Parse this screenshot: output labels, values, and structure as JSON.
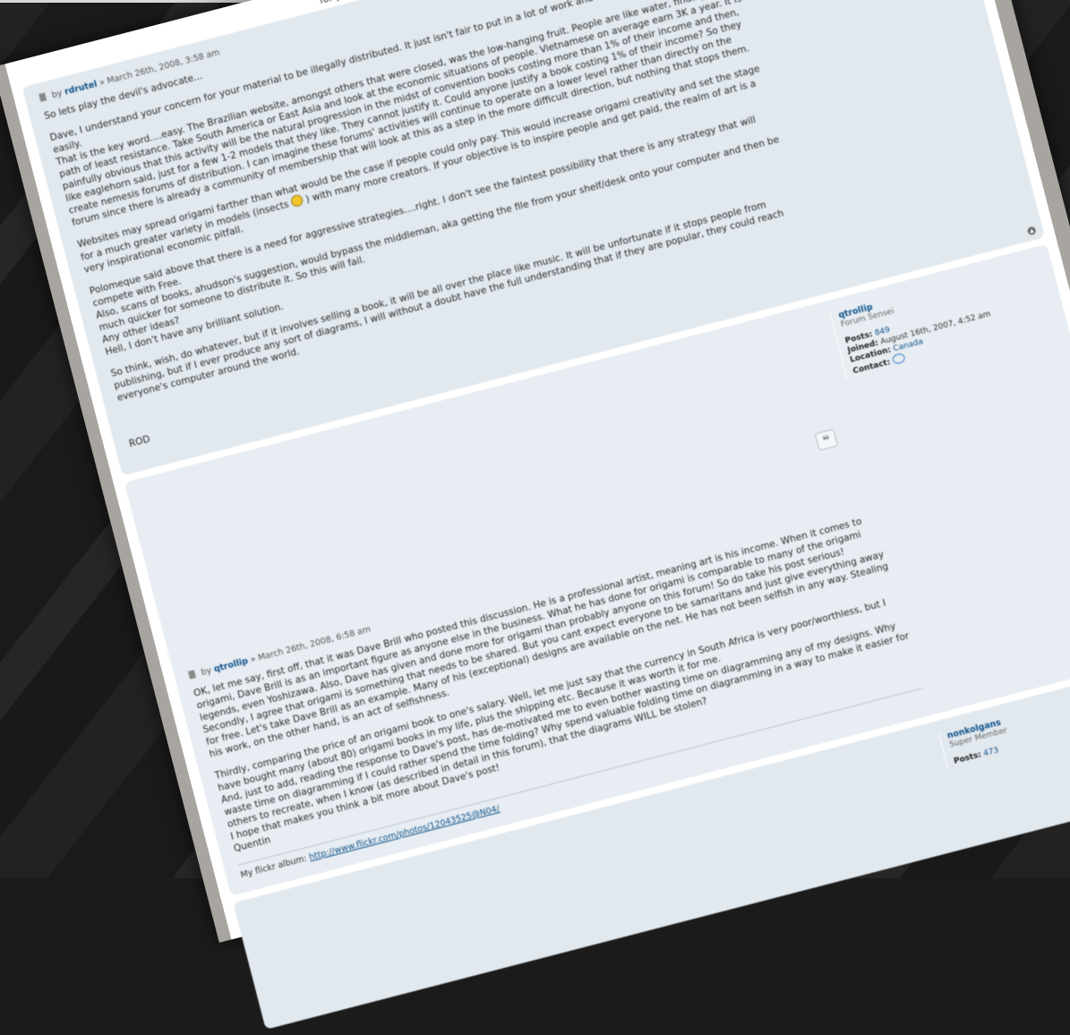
{
  "post1": {
    "author": "rdrutel",
    "by": "by",
    "date": "» March 26th, 2008, 3:58 am",
    "top_header_text": "for your material to be illegally distributed. It just isn't fair to put in a lot of work and effort and have it taken",
    "paragraphs": [
      "So lets play the devil's advocate...",
      "Dave, I understand your concern for your material to be illegally distributed. It just isn't fair to put in a lot of work and effort and have it taken easily.",
      "That is the key word....easy. The Brazilian website, amongst others that were closed, was the low-hanging fruit. People are like water, finding the path of least resistance. Take South America or East Asia and look at the economic situations of people. Vietnamese on average earn 3K a year. It is painfully obvious that this activity will be the natural progression in the midst of convention books costing more than 1% of their income and then, like eaglehorn said, just for a few 1-2 models that they like. They cannot justify it. Could anyone justify a book costing 1% of their income? So they create nemesis forums of distribution. I can imagine these forums' activities will continue to operate on a lower level rather than directly on the forum since there is already a community of membership that will look at this as a step in the more difficult direction, but nothing that stops them.",
      "Websites may spread origami farther than what would be the case if people could only pay. This would increase origami creativity and set the stage for a much greater variety in models (insects",
      ") with many more creators. If your objective is to inspire people and get paid, the realm of art is a very inspirational economic pitfall.",
      "Polomeque said above that there is a need for aggressive strategies....right. I don't see the faintest possibility that there is any strategy that will compete with Free.",
      "Also, scans of books, ahudson's suggestion, would bypass the middleman, aka getting the file from your shelf/desk onto your computer and then be much quicker for someone to distribute it. So this will fail.",
      "Any other ideas?",
      "Hell, I don't have any brilliant solution.",
      "So think, wish, do whatever, but if it involves selling a book, it will be all over the place like music. It will be unfortunate if it stops people from publishing, but if I ever produce any sort of diagrams, I will without a doubt have the full understanding that if they are popular, they could reach everyone's computer around the world.",
      "ROD"
    ]
  },
  "post2": {
    "author": "qtrollip",
    "by": "by",
    "date": "» March 26th, 2008, 6:58 am",
    "profile": {
      "name": "qtrollip",
      "rank": "Forum Sensei",
      "posts_label": "Posts:",
      "posts": "849",
      "joined_label": "Joined:",
      "joined": "August 16th, 2007, 4:52 am",
      "location_label": "Location:",
      "location": "Canada",
      "contact_label": "Contact:"
    },
    "paragraphs": [
      "OK, let me say, first off, that it was Dave Brill who posted this discussion. He is a professional artist, meaning art is his income. When it comes to origami, Dave Brill is as an important figure as anyone else in the business. What he has done for origami is comparable to many of the origami legends, even Yoshizawa. Also, Dave has given and done more for origami than probably anyone on this forum! So do take his post serious!",
      "Secondly, I agree that origami is something that needs to be shared. But you cant expect everyone to be samaritans and just give everything away for free. Let's take Dave Brill as an example. Many of his (exceptional) designs are available on the net. He has not been selfish in any way. Stealing his work, on the other hand, is an act of selfishness.",
      "Thirdly, comparing the price of an origami book to one's salary. Well, let me just say that the currency in South Africa is very poor/worthless, but I have bought many (about 80) origami books in my life, plus the shipping etc. Because it was worth it for me.",
      "And, just to add, reading the response to Dave's post, has de-motivated me to even bother wasting time on diagramming any of my designs. Why waste time on diagramming if I could rather spend the time folding? Why spend valuable folding time on diagramming in a way to make it easier for others to recreate, when I know (as described in detail in this forum), that the diagrams WILL be stolen?",
      "I hope that makes you think a bit more about Dave's post!",
      "Quentin"
    ],
    "signature_label": "My flickr album:",
    "signature_link": "http://www.flickr.com/photos/12043525@N04/"
  },
  "post3": {
    "profile": {
      "name": "nonkolgans",
      "rank": "Super Member",
      "posts_label": "Posts:",
      "posts": "473"
    }
  },
  "icons": {
    "quote": "quote-icon",
    "top": "back-to-top-icon",
    "contact": "contact-bubble-icon",
    "post_file": "post-file-icon",
    "smiley": "smiley-icon"
  }
}
